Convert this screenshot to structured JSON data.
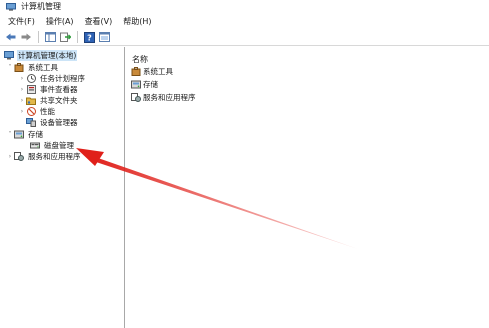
{
  "window": {
    "title": "计算机管理"
  },
  "menu": [
    {
      "label": "文件(F)"
    },
    {
      "label": "操作(A)"
    },
    {
      "label": "查看(V)"
    },
    {
      "label": "帮助(H)"
    }
  ],
  "toolbar": {
    "icons": [
      "back-arrow-icon",
      "forward-arrow-icon",
      "show-tree-icon",
      "export-icon",
      "help-icon",
      "properties-icon"
    ]
  },
  "tree": {
    "root": "计算机管理(本地)",
    "system_tools": "系统工具",
    "task_scheduler": "任务计划程序",
    "event_viewer": "事件查看器",
    "shared_folders": "共享文件夹",
    "performance": "性能",
    "device_manager": "设备管理器",
    "storage": "存储",
    "disk_management": "磁盘管理",
    "services_apps": "服务和应用程序"
  },
  "list": {
    "column_name": "名称",
    "items": [
      {
        "label": "系统工具"
      },
      {
        "label": "存储"
      },
      {
        "label": "服务和应用程序"
      }
    ]
  },
  "colors": {
    "annotation_arrow": "#e0201a",
    "selection": "#cce4f7"
  }
}
